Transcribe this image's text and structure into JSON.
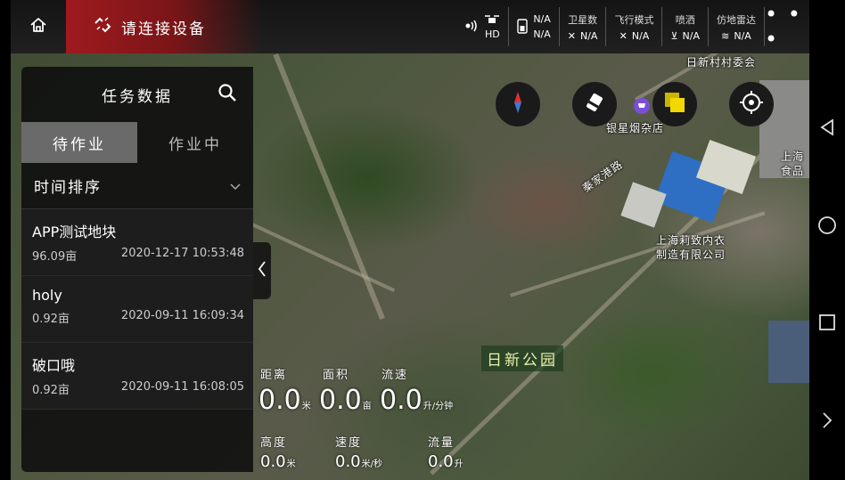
{
  "topbar": {
    "connect_label": "请连接设备",
    "battery_values": [
      "N/A",
      "N/A"
    ],
    "remote_label": "HD",
    "satellite": {
      "label": "卫星数",
      "value": "N/A"
    },
    "flight_mode": {
      "label": "飞行模式",
      "value": "N/A"
    },
    "spray": {
      "label": "喷洒",
      "value": "N/A"
    },
    "radar": {
      "label": "仿地雷达",
      "value": "N/A"
    },
    "more_label": "• • •",
    "accent_color": "#9e1a1e"
  },
  "panel": {
    "title": "任务数据",
    "tabs": [
      {
        "label": "待作业",
        "active": true
      },
      {
        "label": "作业中",
        "active": false
      }
    ],
    "sort_label": "时间排序",
    "tasks": [
      {
        "name": "APP测试地块",
        "area": "96.09亩",
        "time": "2020-12-17 10:53:48"
      },
      {
        "name": "holy",
        "area": "0.92亩",
        "time": "2020-09-11 16:09:34"
      },
      {
        "name": "破口哦",
        "area": "0.92亩",
        "time": "2020-09-11 16:08:05"
      }
    ]
  },
  "map": {
    "labels": {
      "village": "日新村村委会",
      "store": "银星烟杂店",
      "road": "秦家港路",
      "factory_line1": "上海莉致内衣",
      "factory_line2": "制造有限公司",
      "food_line1": "上海",
      "food_line2": "食品",
      "park": "日新公园"
    }
  },
  "readouts": {
    "distance": {
      "label": "距离",
      "value": "0.0",
      "unit": "米"
    },
    "area": {
      "label": "面积",
      "value": "0.0",
      "unit": "亩"
    },
    "flow_rate": {
      "label": "流速",
      "value": "0.0",
      "unit": "升/分钟"
    },
    "height": {
      "label": "高度",
      "value": "0.0",
      "unit": "米"
    },
    "speed": {
      "label": "速度",
      "value": "0.0",
      "unit": "米/秒"
    },
    "flow": {
      "label": "流量",
      "value": "0.0",
      "unit": "升"
    }
  },
  "icons": [
    "home-icon",
    "unlink-icon",
    "signal-icon",
    "drone-icon",
    "battery-icon",
    "satellite-icon",
    "flight-icon",
    "spray-icon",
    "radar-icon",
    "search-icon",
    "chevron-down-icon",
    "chevron-left-icon",
    "compass-icon",
    "eraser-icon",
    "layers-icon",
    "locate-icon",
    "shop-icon",
    "back-icon",
    "home-circle-icon",
    "recents-icon",
    "chevron-right-icon"
  ]
}
